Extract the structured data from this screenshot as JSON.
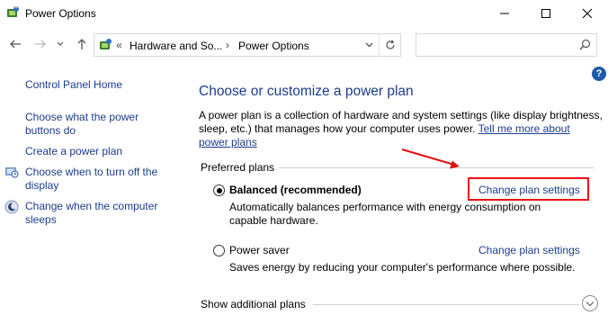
{
  "window": {
    "title": "Power Options"
  },
  "address": {
    "crumb_root": "Hardware and So...",
    "crumb_current": "Power Options",
    "search_placeholder": ""
  },
  "left_nav": {
    "home": "Control Panel Home",
    "items": [
      {
        "label_line1": "Choose what the power",
        "label_line2": "buttons do"
      },
      {
        "label_line1": "Create a power plan",
        "label_line2": ""
      }
    ],
    "also": [
      {
        "label_line1": "Choose when to turn off the",
        "label_line2": "display"
      },
      {
        "label_line1": "Change when the computer",
        "label_line2": "sleeps"
      }
    ]
  },
  "main": {
    "heading": "Choose or customize a power plan",
    "desc_line1": "A power plan is a collection of hardware and system settings (like display brightness,",
    "desc_line2_text": "sleep, etc.) that manages how your computer uses power.",
    "desc_line2_link": "Tell me more about",
    "desc_line3_link": "power plans",
    "preferred_label": "Preferred plans",
    "plans": [
      {
        "name": "Balanced (recommended)",
        "selected": true,
        "desc_line1": "Automatically balances performance with energy consumption on",
        "desc_line2": "capable hardware.",
        "change_link": "Change plan settings"
      },
      {
        "name": "Power saver",
        "selected": false,
        "desc_line1": "Saves energy by reducing your computer's performance where possible.",
        "desc_line2": "",
        "change_link": "Change plan settings"
      }
    ],
    "show_additional": "Show additional plans"
  },
  "help_label": "?",
  "annotation_color": "#e11111",
  "link_color": "#1b3c8d"
}
